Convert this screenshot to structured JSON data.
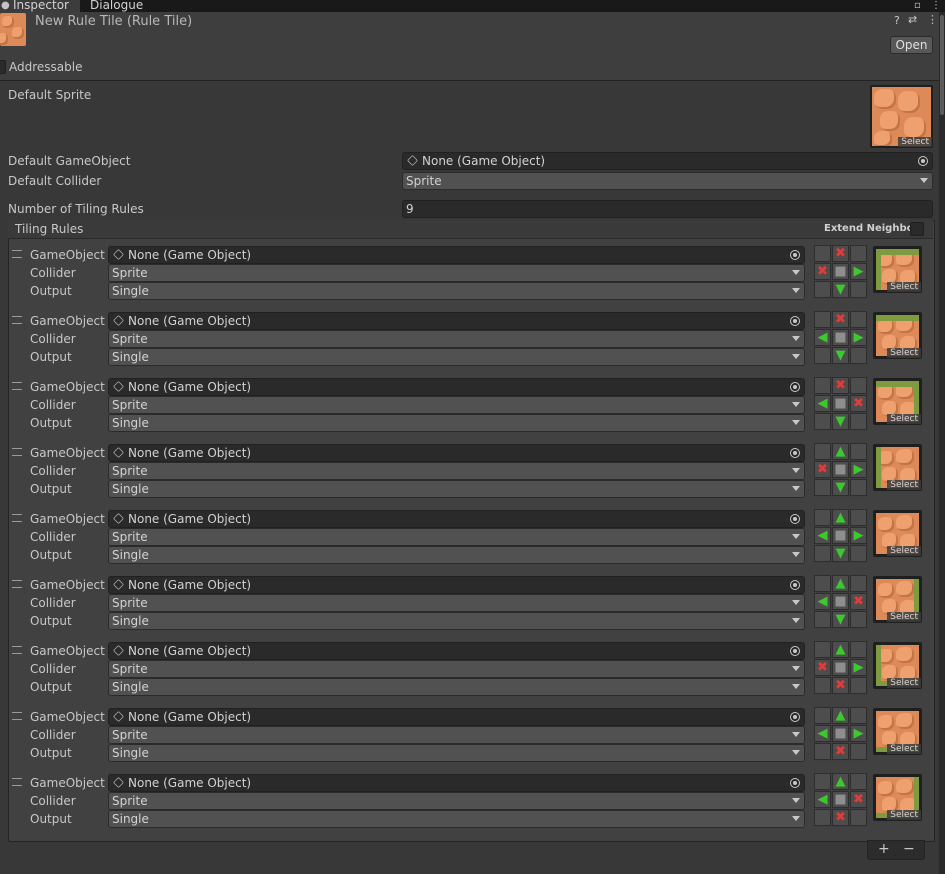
{
  "tabs": [
    {
      "label": "Inspector",
      "active": true
    },
    {
      "label": "Dialogue",
      "active": false
    }
  ],
  "header": {
    "title": "New Rule Tile (Rule Tile)",
    "open_label": "Open",
    "addressable_label": "Addressable"
  },
  "default_sprite": {
    "label": "Default Sprite",
    "select": "Select"
  },
  "default_gameobject": {
    "label": "Default GameObject",
    "value": "None (Game Object)"
  },
  "default_collider": {
    "label": "Default Collider",
    "value": "Sprite"
  },
  "tiling_count": {
    "label": "Number of Tiling Rules",
    "value": "9"
  },
  "tiling_rules": {
    "title": "Tiling Rules",
    "extend_neighbor": "Extend Neighbor",
    "field_labels": {
      "gameobject": "GameObject",
      "collider": "Collider",
      "output": "Output"
    },
    "rules": [
      {
        "gameobject": "None (Game Object)",
        "collider": "Sprite",
        "output": "Single",
        "neighbors": [
          "",
          "x",
          "",
          "x",
          "c",
          "right",
          "",
          "down",
          ""
        ],
        "select": "Select"
      },
      {
        "gameobject": "None (Game Object)",
        "collider": "Sprite",
        "output": "Single",
        "neighbors": [
          "",
          "x",
          "",
          "left",
          "c",
          "right",
          "",
          "down",
          ""
        ],
        "select": "Select"
      },
      {
        "gameobject": "None (Game Object)",
        "collider": "Sprite",
        "output": "Single",
        "neighbors": [
          "",
          "x",
          "",
          "left",
          "c",
          "x",
          "",
          "down",
          ""
        ],
        "select": "Select"
      },
      {
        "gameobject": "None (Game Object)",
        "collider": "Sprite",
        "output": "Single",
        "neighbors": [
          "",
          "up",
          "",
          "x",
          "c",
          "right",
          "",
          "down",
          ""
        ],
        "select": "Select"
      },
      {
        "gameobject": "None (Game Object)",
        "collider": "Sprite",
        "output": "Single",
        "neighbors": [
          "",
          "up",
          "",
          "left",
          "c",
          "right",
          "",
          "down",
          ""
        ],
        "select": "Select"
      },
      {
        "gameobject": "None (Game Object)",
        "collider": "Sprite",
        "output": "Single",
        "neighbors": [
          "",
          "up",
          "",
          "left",
          "c",
          "x",
          "",
          "down",
          ""
        ],
        "select": "Select"
      },
      {
        "gameobject": "None (Game Object)",
        "collider": "Sprite",
        "output": "Single",
        "neighbors": [
          "",
          "up",
          "",
          "x",
          "c",
          "right",
          "",
          "x",
          ""
        ],
        "select": "Select"
      },
      {
        "gameobject": "None (Game Object)",
        "collider": "Sprite",
        "output": "Single",
        "neighbors": [
          "",
          "up",
          "",
          "left",
          "c",
          "right",
          "",
          "x",
          ""
        ],
        "select": "Select"
      },
      {
        "gameobject": "None (Game Object)",
        "collider": "Sprite",
        "output": "Single",
        "neighbors": [
          "",
          "up",
          "",
          "left",
          "c",
          "x",
          "",
          "x",
          ""
        ],
        "select": "Select"
      }
    ]
  },
  "footer": {
    "add": "+",
    "remove": "−"
  },
  "icons": {
    "help": "?",
    "presets": "⇄",
    "menu": "⋮",
    "lock": "🔒"
  }
}
